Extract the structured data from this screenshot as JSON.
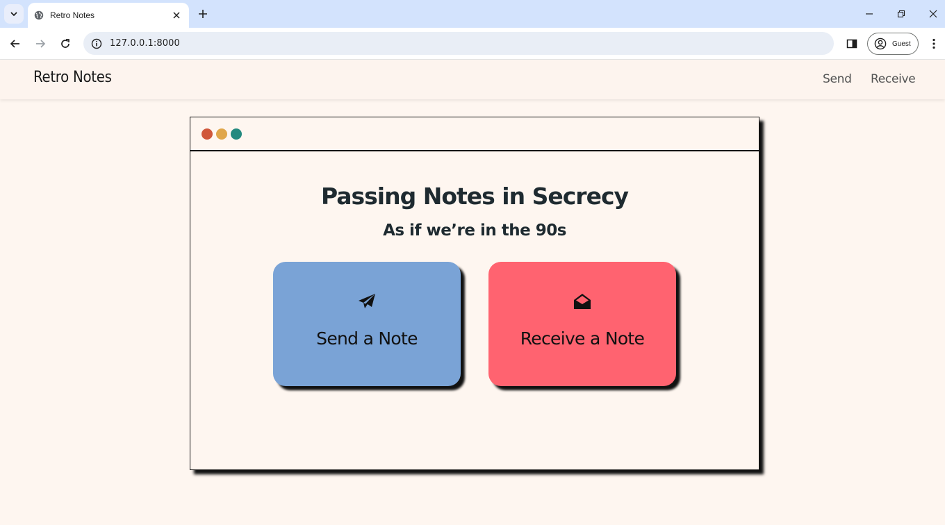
{
  "browser": {
    "tab_title": "Retro Notes",
    "url": "127.0.0.1:8000",
    "profile_label": "Guest",
    "icons": {
      "tab_search": "chevron-down-icon",
      "favicon": "globe-icon",
      "tab_close": "close-icon",
      "new_tab": "plus-icon",
      "minimize": "minimize-icon",
      "restore": "restore-icon",
      "close_window": "close-icon",
      "back": "arrow-left-icon",
      "forward": "arrow-right-icon",
      "reload": "reload-icon",
      "site_info": "info-icon",
      "side_panel": "side-panel-icon",
      "profile": "account-icon",
      "menu": "kebab-menu-icon"
    }
  },
  "site": {
    "brand": "Retro Notes",
    "nav": [
      {
        "label": "Send"
      },
      {
        "label": "Receive"
      }
    ]
  },
  "window": {
    "dot_colors": [
      "#d0573a",
      "#e0a64a",
      "#23897f"
    ]
  },
  "hero": {
    "title": "Passing Notes in Secrecy",
    "subtitle": "As if we’re in the 90s"
  },
  "cards": [
    {
      "label": "Send a Note",
      "icon": "paper-plane-icon",
      "color": "#7aa3d6"
    },
    {
      "label": "Receive a Note",
      "icon": "envelope-open-icon",
      "color": "#ff6370"
    }
  ]
}
